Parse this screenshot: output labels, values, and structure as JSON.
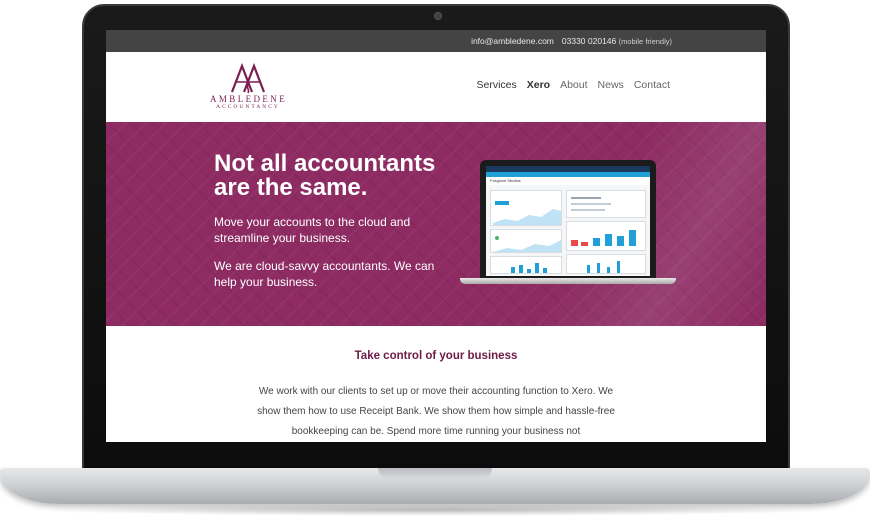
{
  "topbar": {
    "email": "info@ambledene.com",
    "phone": "03330 020146",
    "phone_note": "(mobile friendly)"
  },
  "logo": {
    "monogram": "AA",
    "name": "AMBLEDENE",
    "sub": "ACCOUNTANCY",
    "color": "#7a1f52"
  },
  "nav": {
    "items": [
      "Services",
      "Xero",
      "About",
      "News",
      "Contact"
    ]
  },
  "hero": {
    "title_line1": "Not all accountants",
    "title_line2": "are the same.",
    "p1": "Move your accounts to the cloud and streamline your business.",
    "p2": "We are cloud-savvy accountants. We can help your business.",
    "bg_color": "#8d2b62",
    "mini_screen_title": "Foxglove Studios"
  },
  "content": {
    "heading": "Take control of your business",
    "paragraph": "We work with our clients to set up or move their accounting function to Xero. We show them how to use Receipt Bank. We show them how simple and hassle-free bookkeeping can be. Spend more time running your business not"
  }
}
